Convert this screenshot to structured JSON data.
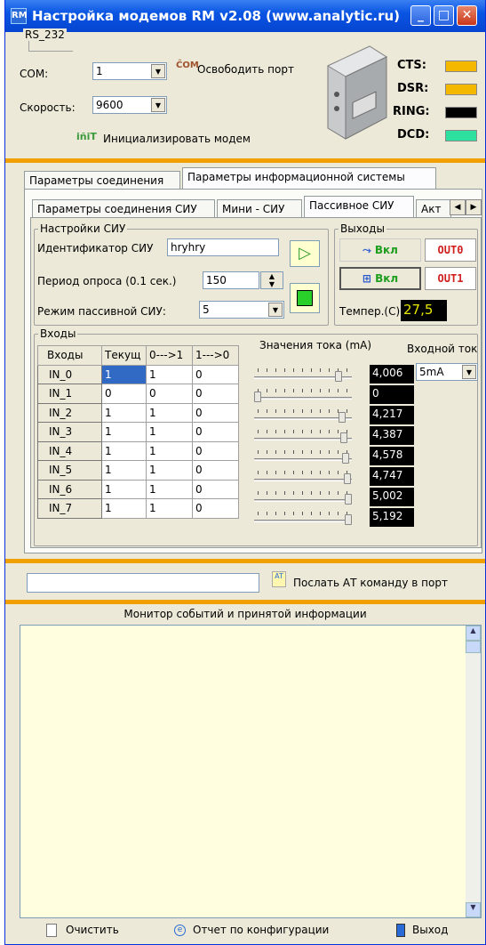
{
  "window": {
    "title": "Настройка модемов RM v2.08 (www.analytic.ru)",
    "app_icon_text": "RM"
  },
  "rs232": {
    "legend": "RS_232",
    "com_label": "COM:",
    "com_value": "1",
    "release_port_label": "Освободить порт",
    "speed_label": "Скорость:",
    "speed_value": "9600",
    "init_modem_label": "Инициализировать модем",
    "lamps": [
      {
        "label": "CTS:",
        "color": "#F5B800"
      },
      {
        "label": "DSR:",
        "color": "#F5B800"
      },
      {
        "label": "RING:",
        "color": "#000000"
      },
      {
        "label": "DCD:",
        "color": "#2EE0A0"
      }
    ]
  },
  "outer_tabs": [
    "Параметры соединения",
    "Параметры информационной системы"
  ],
  "inner_tabs": [
    "Параметры соединения СИУ",
    "Мини - СИУ",
    "Пассивное СИУ",
    "Акт"
  ],
  "siu_settings": {
    "legend": "Настройки СИУ",
    "id_label": "Идентификатор СИУ",
    "id_value": "hryhry",
    "period_label": "Период опроса (0.1 сек.)",
    "period_value": "150",
    "mode_label": "Режим пассивной СИУ:",
    "mode_value": "5"
  },
  "outputs": {
    "legend": "Выходы",
    "btn1_label": "Вкл",
    "btn2_label": "Вкл",
    "out0_label": "OUT0",
    "out1_label": "OUT1",
    "temp_label": "Темпер.(С):",
    "temp_value": "27,5"
  },
  "inputs": {
    "legend": "Входы",
    "columns": [
      "Входы",
      "Текущ",
      "0--->1",
      "1--->0"
    ],
    "current_header": "Значения тока (mA)",
    "input_current_header": "Входной ток",
    "input_current_value": "5mA",
    "rows": [
      {
        "name": "IN_0",
        "cur": "1",
        "up": "1",
        "down": "0",
        "value": "4,006",
        "level": 0.89
      },
      {
        "name": "IN_1",
        "cur": "0",
        "up": "0",
        "down": "0",
        "value": "0",
        "level": 0.0
      },
      {
        "name": "IN_2",
        "cur": "1",
        "up": "1",
        "down": "0",
        "value": "4,217",
        "level": 0.93
      },
      {
        "name": "IN_3",
        "cur": "1",
        "up": "1",
        "down": "0",
        "value": "4,387",
        "level": 0.95
      },
      {
        "name": "IN_4",
        "cur": "1",
        "up": "1",
        "down": "0",
        "value": "4,578",
        "level": 0.97
      },
      {
        "name": "IN_5",
        "cur": "1",
        "up": "1",
        "down": "0",
        "value": "4,747",
        "level": 0.99
      },
      {
        "name": "IN_6",
        "cur": "1",
        "up": "1",
        "down": "0",
        "value": "5,002",
        "level": 1.0
      },
      {
        "name": "IN_7",
        "cur": "1",
        "up": "1",
        "down": "0",
        "value": "5,192",
        "level": 1.0
      }
    ]
  },
  "at_command": {
    "value": "",
    "button_label": "Послать АТ команду в порт"
  },
  "monitor": {
    "title": "Монитор событий  и  принятой информации",
    "content": ""
  },
  "footer": {
    "clear_label": "Очистить",
    "report_label": "Отчет по конфигурации",
    "exit_label": "Выход"
  }
}
